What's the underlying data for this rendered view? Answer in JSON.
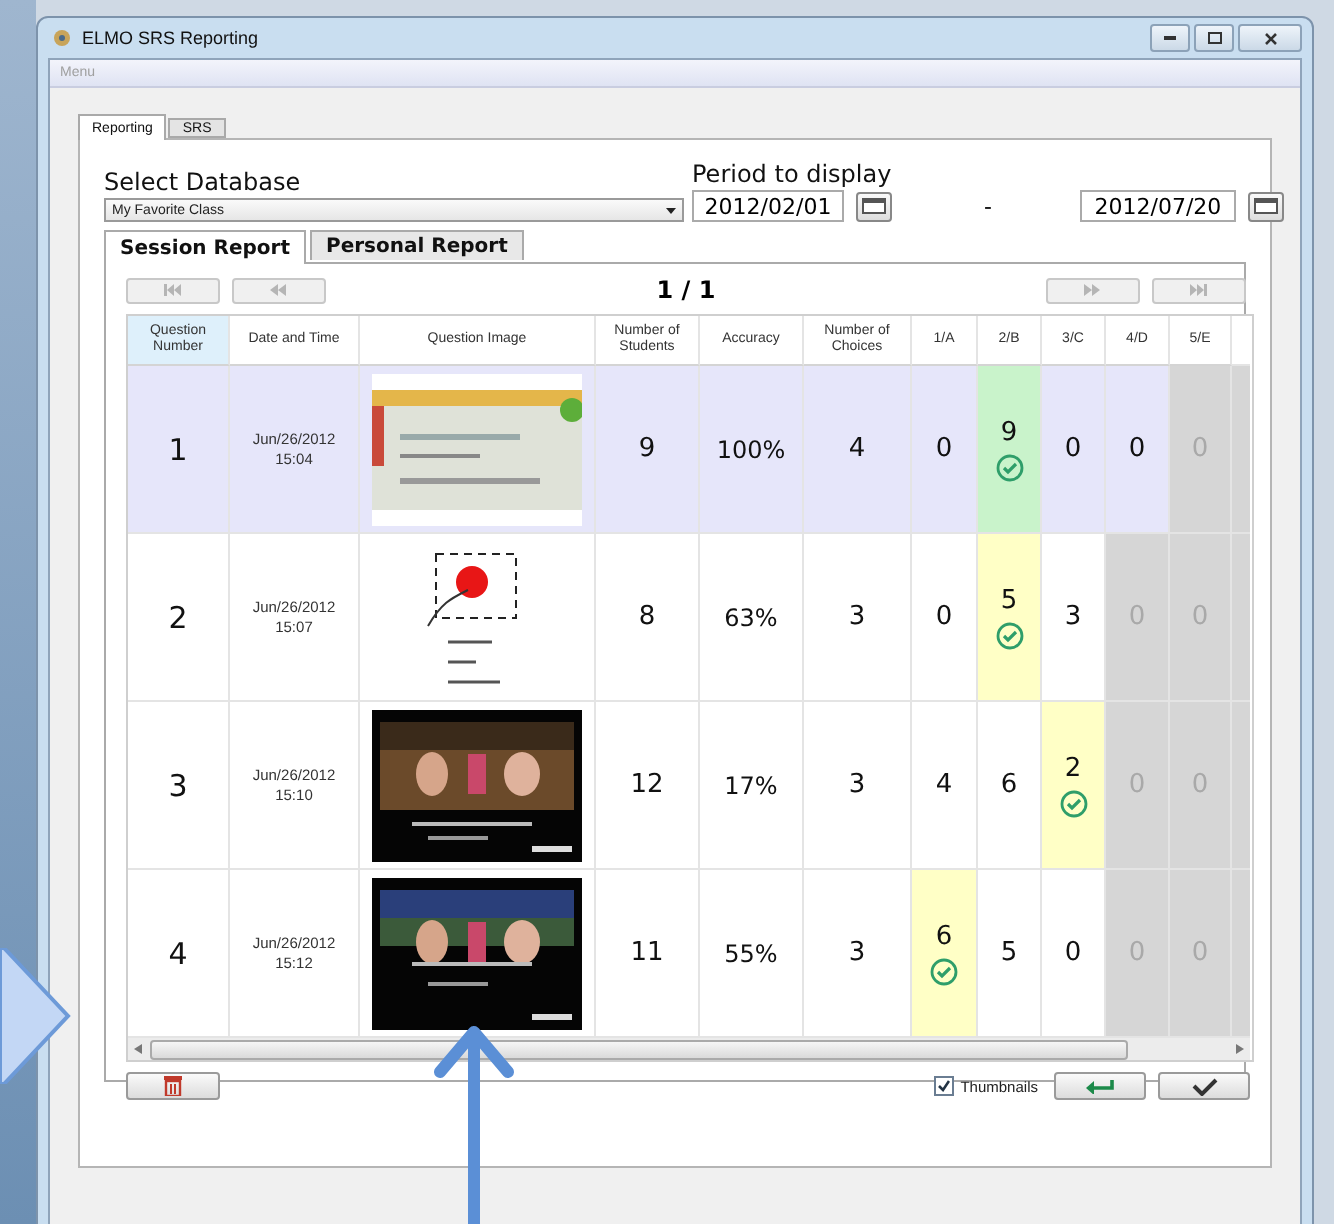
{
  "window": {
    "title": "ELMO SRS Reporting"
  },
  "menu": "Menu",
  "tabs": [
    {
      "label": "Reporting",
      "selected": true
    },
    {
      "label": "SRS",
      "selected": false
    }
  ],
  "database": {
    "label": "Select Database",
    "value": "My Favorite Class"
  },
  "period": {
    "label": "Period to display",
    "from": "2012/02/01",
    "separator": "-",
    "to": "2012/07/20"
  },
  "report_tabs": [
    {
      "label": "Session Report",
      "selected": true
    },
    {
      "label": "Personal Report",
      "selected": false
    }
  ],
  "pager": {
    "page": "1 / 1"
  },
  "table": {
    "columns": [
      {
        "label": "Question Number",
        "sorted": true
      },
      {
        "label": "Date and Time",
        "sorted": false
      },
      {
        "label": "Question Image",
        "sorted": false
      },
      {
        "label": "Number of Students",
        "sorted": false
      },
      {
        "label": "Accuracy",
        "sorted": false
      },
      {
        "label": "Number of Choices",
        "sorted": false
      },
      {
        "label": "1/A",
        "sorted": false
      },
      {
        "label": "2/B",
        "sorted": false
      },
      {
        "label": "3/C",
        "sorted": false
      },
      {
        "label": "4/D",
        "sorted": false
      },
      {
        "label": "5/E",
        "sorted": false
      }
    ],
    "rows": [
      {
        "number": "1",
        "date": "Jun/26/2012",
        "time": "15:04",
        "students": "9",
        "accuracy": "100%",
        "choices": "4",
        "selected": true,
        "answers": [
          {
            "value": "0",
            "correct": false,
            "disabled": false
          },
          {
            "value": "9",
            "correct": true,
            "disabled": false
          },
          {
            "value": "0",
            "correct": false,
            "disabled": false
          },
          {
            "value": "0",
            "correct": false,
            "disabled": false
          },
          {
            "value": "0",
            "correct": false,
            "disabled": true
          }
        ]
      },
      {
        "number": "2",
        "date": "Jun/26/2012",
        "time": "15:07",
        "students": "8",
        "accuracy": "63%",
        "choices": "3",
        "selected": false,
        "answers": [
          {
            "value": "0",
            "correct": false,
            "disabled": false
          },
          {
            "value": "5",
            "correct": true,
            "disabled": false
          },
          {
            "value": "3",
            "correct": false,
            "disabled": false
          },
          {
            "value": "0",
            "correct": false,
            "disabled": true
          },
          {
            "value": "0",
            "correct": false,
            "disabled": true
          }
        ]
      },
      {
        "number": "3",
        "date": "Jun/26/2012",
        "time": "15:10",
        "students": "12",
        "accuracy": "17%",
        "choices": "3",
        "selected": false,
        "answers": [
          {
            "value": "4",
            "correct": false,
            "disabled": false
          },
          {
            "value": "6",
            "correct": false,
            "disabled": false
          },
          {
            "value": "2",
            "correct": true,
            "disabled": false
          },
          {
            "value": "0",
            "correct": false,
            "disabled": true
          },
          {
            "value": "0",
            "correct": false,
            "disabled": true
          }
        ]
      },
      {
        "number": "4",
        "date": "Jun/26/2012",
        "time": "15:12",
        "students": "11",
        "accuracy": "55%",
        "choices": "3",
        "selected": false,
        "answers": [
          {
            "value": "6",
            "correct": true,
            "disabled": false
          },
          {
            "value": "5",
            "correct": false,
            "disabled": false
          },
          {
            "value": "0",
            "correct": false,
            "disabled": false
          },
          {
            "value": "0",
            "correct": false,
            "disabled": true
          },
          {
            "value": "0",
            "correct": false,
            "disabled": true
          }
        ]
      }
    ]
  },
  "thumbnails": {
    "label": "Thumbnails",
    "checked": true
  }
}
